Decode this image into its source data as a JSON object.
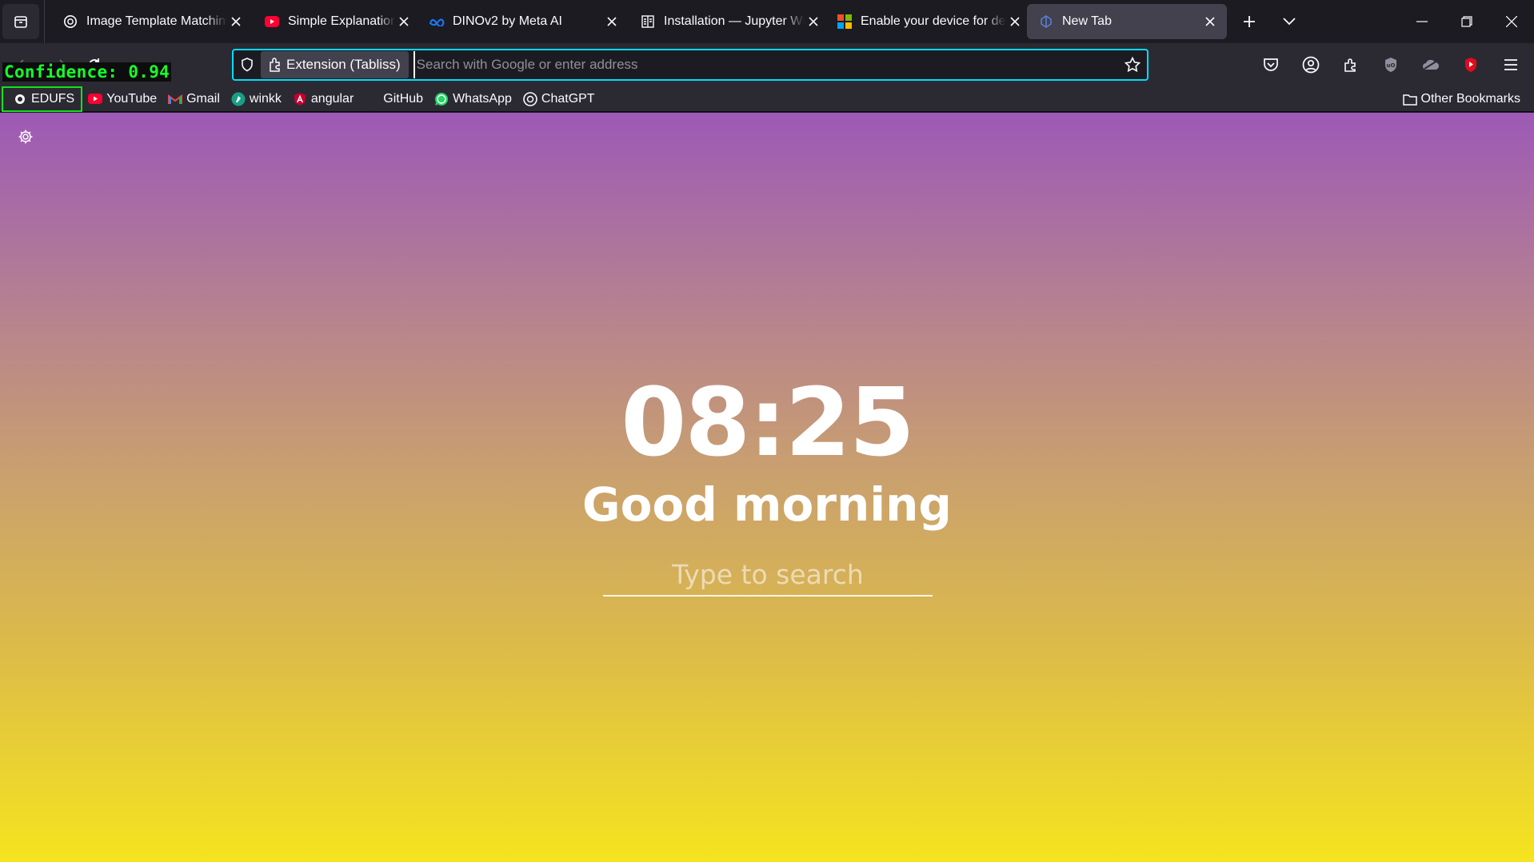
{
  "overlay": {
    "confidence_label": "Confidence: 0.94"
  },
  "tabs": [
    {
      "title": "Image Template Matching",
      "icon": "chatgpt-icon",
      "active": false
    },
    {
      "title": "Simple Explanation of Siamese Networks",
      "icon": "youtube-icon",
      "active": false
    },
    {
      "title": "DINOv2 by Meta AI",
      "icon": "meta-icon",
      "active": false
    },
    {
      "title": "Installation — Jupyter Widgets",
      "icon": "docs-icon",
      "active": false
    },
    {
      "title": "Enable your device for development",
      "icon": "microsoft-icon",
      "active": false
    },
    {
      "title": "New Tab",
      "icon": "tabliss-icon",
      "active": true
    }
  ],
  "navbar": {
    "identity_label": "Extension (Tabliss)",
    "url_placeholder": "Search with Google or enter address",
    "url_value": ""
  },
  "bookmarks": [
    {
      "label": "EDUFS",
      "icon": "edufs-icon",
      "highlighted": true
    },
    {
      "label": "YouTube",
      "icon": "youtube-icon"
    },
    {
      "label": "Gmail",
      "icon": "gmail-icon"
    },
    {
      "label": "winkk",
      "icon": "winkk-icon"
    },
    {
      "label": "angular",
      "icon": "angular-icon"
    },
    {
      "label": "GitHub",
      "icon": "github-icon"
    },
    {
      "label": "WhatsApp",
      "icon": "whatsapp-icon"
    },
    {
      "label": "ChatGPT",
      "icon": "chatgpt-icon"
    }
  ],
  "other_bookmarks_label": "Other Bookmarks",
  "page": {
    "time": "08:25",
    "greeting": "Good morning",
    "search_placeholder": "Type to search",
    "gradient": {
      "top": "#9d59b6",
      "bottom": "#f5e41f"
    }
  }
}
